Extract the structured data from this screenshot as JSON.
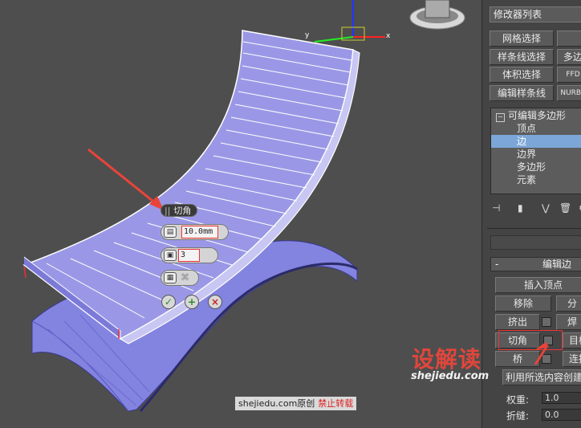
{
  "viewport": {
    "axis_labels": {
      "x": "x",
      "y": "y"
    },
    "caddy": {
      "title": "切角",
      "amount_value": "10.0mm",
      "segments_value": "3",
      "ok_icon": "check-icon",
      "apply_icon": "plus-icon",
      "cancel_icon": "close-icon"
    },
    "colors": {
      "mesh_fill": "#9a98e6",
      "mesh_edge": "#ffffff",
      "base_fill": "#7f7fe0",
      "annotation": "#e8443a"
    }
  },
  "watermark": {
    "prefix": "shejiedu.com原创",
    "suffix": "禁止转载"
  },
  "brand": {
    "logo": "设解读",
    "url": "shejiedu.com"
  },
  "panel": {
    "modifier_list": "修改器列表",
    "buttons": [
      {
        "label": "网格选择"
      },
      {
        "label": "样条线选择"
      },
      {
        "label": "体积选择"
      },
      {
        "label": "编辑样条线"
      }
    ],
    "right_buttons": [
      "多边",
      "FFD",
      "NURBS"
    ],
    "stack": {
      "root": "可编辑多边形",
      "items": [
        "顶点",
        "边",
        "边界",
        "多边形",
        "元素"
      ],
      "selected_index": 1
    },
    "rollout_title": "编辑边",
    "edit_edge": {
      "insert_vertex": "插入顶点",
      "remove": "移除",
      "split": "分",
      "extrude": "挤出",
      "weld": "焊",
      "chamfer": "切角",
      "target": "目标",
      "bridge": "桥",
      "connect": "连接",
      "hint": "利用所选内容创建"
    },
    "weight_label": "权重:",
    "weight_value": "1.0",
    "crease_label": "折缝:",
    "crease_value": "0.0"
  }
}
